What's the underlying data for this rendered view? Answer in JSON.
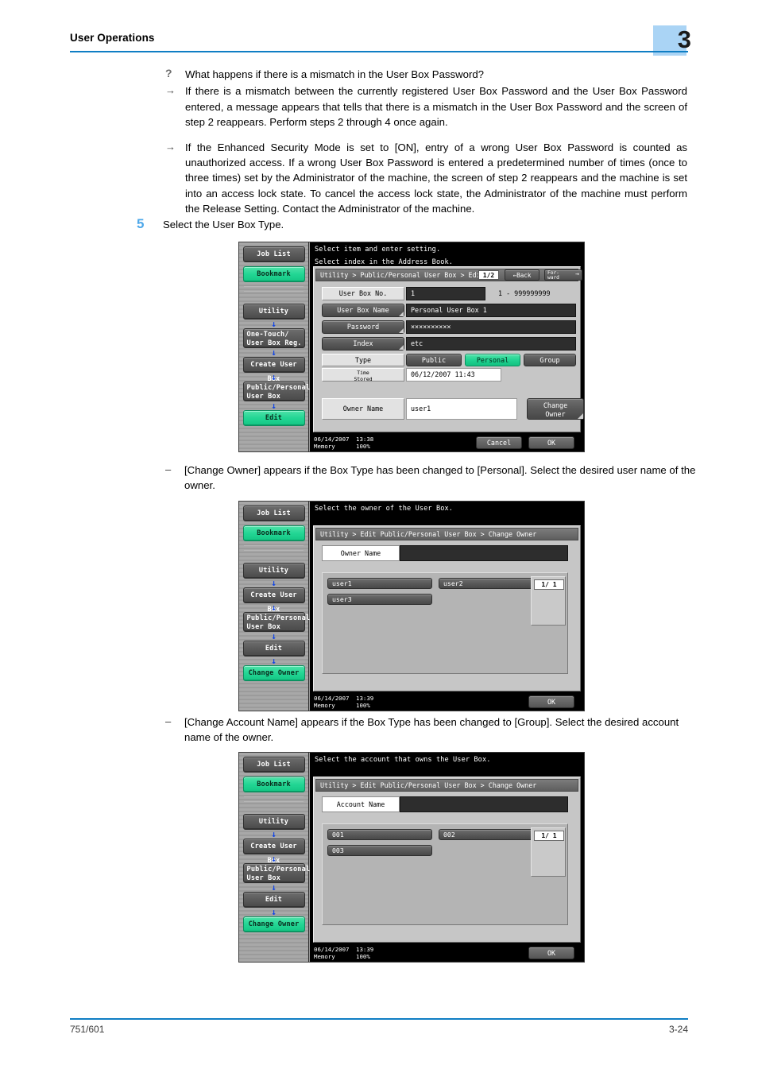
{
  "header": {
    "title": "User Operations",
    "chapter": "3"
  },
  "footer": {
    "model": "751/601",
    "page": "3-24"
  },
  "qa": {
    "question_mark": "?",
    "question": "What happens if there is a mismatch in the User Box Password?",
    "arrow": "→",
    "answer1": "If there is a mismatch between the currently registered User Box Password and the User Box Password entered, a message appears that tells that there is a mismatch in the User Box Password and the screen of step 2 reappears. Perform steps 2 through 4 once again.",
    "answer2": "If the Enhanced Security Mode is set to [ON], entry of a wrong User Box Password is counted as unauthorized access. If a wrong User Box Password is entered a predetermined number of times (once to three times) set by the Administrator of the machine, the screen of step 2 reappears and the machine is set into an access lock state. To cancel the access lock state, the Administrator of the machine must perform the Release Setting. Contact the Administrator of the machine."
  },
  "step": {
    "number": "5",
    "text": "Select the User Box Type."
  },
  "bullets": {
    "dash": "–",
    "b1": "[Change Owner] appears if the Box Type has been changed to [Personal]. Select the desired user name of the owner.",
    "b2": "[Change Account Name] appears if the Box Type has been changed to [Group]. Select the desired account name of the owner."
  },
  "screen1": {
    "sidebar": {
      "job_list": "Job List",
      "bookmark": "Bookmark",
      "utility": "Utility",
      "one_touch": "One-Touch/\nUser Box Reg.",
      "create_user_box": "Create User Box",
      "public_personal": "Public/Personal\nUser Box",
      "edit": "Edit",
      "arrow": "↓"
    },
    "message_line1": "Select item and enter setting.",
    "message_line2": "Select index in the Address Book.",
    "breadcrumb": "Utility > Public/Personal User  Box > Edit",
    "page_indicator": "1/2",
    "back_button": "←Back",
    "forward_button": "For-\nward",
    "forward_arrow": "→",
    "fields": {
      "user_box_no_label": "User Box No.",
      "user_box_no_value": "1",
      "user_box_no_range": "1  -  999999999",
      "user_box_name_label": "User Box Name",
      "user_box_name_value": "Personal User Box 1",
      "password_label": "Password",
      "password_value": "××××××××××",
      "index_label": "Index",
      "index_value": "etc",
      "type_label": "Type",
      "type_public": "Public",
      "type_personal": "Personal",
      "type_group": "Group",
      "time_stored_label": "Time\nStored",
      "time_stored_value": "06/12/2007   11:43",
      "owner_name_label": "Owner Name",
      "owner_name_value": "user1",
      "change_owner_button": "Change\nOwner"
    },
    "status": {
      "date": "06/14/2007",
      "time": "13:38",
      "memory_label": "Memory",
      "memory_value": "100%",
      "cancel": "Cancel",
      "ok": "OK"
    }
  },
  "screen2": {
    "sidebar": {
      "job_list": "Job List",
      "bookmark": "Bookmark",
      "utility": "Utility",
      "create_user_box": "Create User Box",
      "public_personal": "Public/Personal\nUser Box",
      "edit": "Edit",
      "change_owner": "Change Owner",
      "arrow": "↓"
    },
    "message_line1": "Select the owner of the User Box.",
    "breadcrumb": "Utility > Edit Public/Personal User Box > Change Owner",
    "tab_label": "Owner Name",
    "items": [
      "user1",
      "user2",
      "user3"
    ],
    "page_counter": "1/  1",
    "status": {
      "date": "06/14/2007",
      "time": "13:39",
      "memory_label": "Memory",
      "memory_value": "100%",
      "ok": "OK"
    }
  },
  "screen3": {
    "sidebar": {
      "job_list": "Job List",
      "bookmark": "Bookmark",
      "utility": "Utility",
      "create_user_box": "Create User Box",
      "public_personal": "Public/Personal\nUser Box",
      "edit": "Edit",
      "change_owner": "Change Owner",
      "arrow": "↓"
    },
    "message_line1": "Select the account that owns the User Box.",
    "breadcrumb": "Utility > Edit Public/Personal User Box > Change Owner",
    "tab_label": "Account Name",
    "items": [
      "001",
      "002",
      "003"
    ],
    "page_counter": "1/  1",
    "status": {
      "date": "06/14/2007",
      "time": "13:39",
      "memory_label": "Memory",
      "memory_value": "100%",
      "ok": "OK"
    }
  }
}
